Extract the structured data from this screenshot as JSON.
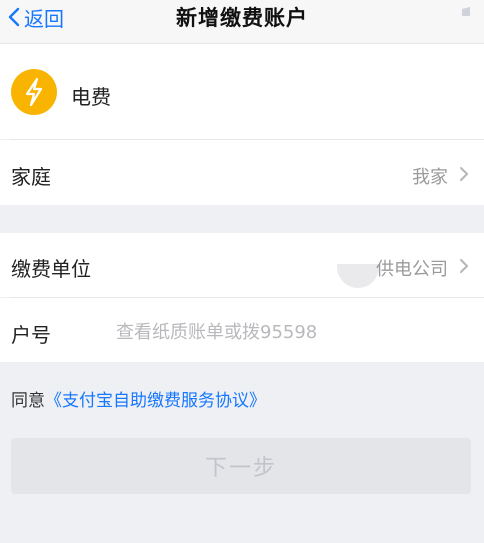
{
  "nav": {
    "back_label": "返回",
    "title": "新增缴费账户"
  },
  "bill": {
    "icon": "lightning-icon",
    "name": "电费",
    "color": "#f8b400"
  },
  "family": {
    "label": "家庭",
    "value": "我家"
  },
  "company": {
    "label": "缴费单位",
    "value": "供电公司"
  },
  "account": {
    "label": "户号",
    "placeholder": "查看纸质账单或拨95598"
  },
  "agreement": {
    "prefix": "同意",
    "link": "《支付宝自助缴费服务协议》"
  },
  "next_button": {
    "label": "下一步"
  },
  "colors": {
    "accent": "#1677ff",
    "background": "#eff0f4",
    "disabled_button": "#e4e5e9"
  }
}
